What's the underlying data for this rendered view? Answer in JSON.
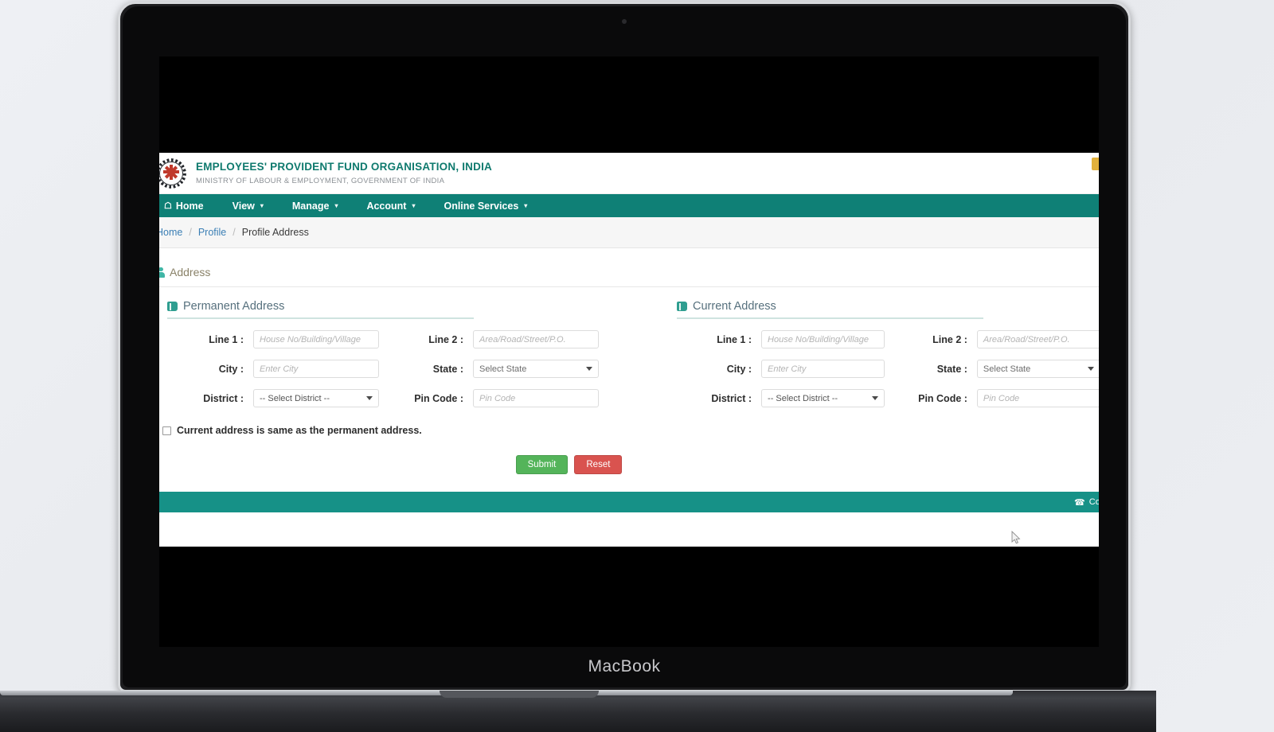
{
  "device": {
    "label": "MacBook"
  },
  "header": {
    "org_name": "EMPLOYEES' PROVIDENT FUND ORGANISATION, INDIA",
    "org_subtitle": "MINISTRY OF LABOUR & EMPLOYMENT, GOVERNMENT OF INDIA",
    "logo_icon": "epfo-emblem-icon"
  },
  "nav": {
    "items": [
      {
        "label": "Home",
        "icon": "home-icon",
        "caret": ""
      },
      {
        "label": "View",
        "icon": "",
        "caret": "▾"
      },
      {
        "label": "Manage",
        "icon": "",
        "caret": "▾"
      },
      {
        "label": "Account",
        "icon": "",
        "caret": "▾"
      },
      {
        "label": "Online Services",
        "icon": "",
        "caret": "▾"
      }
    ]
  },
  "breadcrumb": {
    "home": "Home",
    "sep1": "/",
    "profile": "Profile",
    "sep2": "/",
    "current": "Profile Address"
  },
  "panel": {
    "title": "Address",
    "icon": "user-icon"
  },
  "permanent": {
    "heading": "Permanent Address",
    "icon": "book-icon",
    "fields": {
      "line1_label": "Line 1 :",
      "line1_placeholder": "House No/Building/Village",
      "line2_label": "Line 2 :",
      "line2_placeholder": "Area/Road/Street/P.O.",
      "city_label": "City :",
      "city_placeholder": "Enter City",
      "state_label": "State :",
      "state_value": "Select State",
      "district_label": "District :",
      "district_value": "-- Select District --",
      "pin_label": "Pin Code :",
      "pin_placeholder": "Pin Code"
    }
  },
  "current": {
    "heading": "Current Address",
    "icon": "book-icon",
    "fields": {
      "line1_label": "Line 1 :",
      "line1_placeholder": "House No/Building/Village",
      "line2_label": "Line 2 :",
      "line2_placeholder": "Area/Road/Street/P.O.",
      "city_label": "City :",
      "city_placeholder": "Enter City",
      "state_label": "State :",
      "state_value": "Select State",
      "district_label": "District :",
      "district_value": "-- Select District --",
      "pin_label": "Pin Code :",
      "pin_placeholder": "Pin Code"
    }
  },
  "same_address": {
    "label": "Current address is same as the permanent address.",
    "checked": false
  },
  "actions": {
    "submit_label": "Submit",
    "reset_label": "Reset"
  },
  "footer": {
    "contact_label": "Cont",
    "phone_icon": "phone-icon"
  },
  "colors": {
    "teal": "#0f8076",
    "footer_teal": "#169187",
    "org_green": "#0f7a6e",
    "submit_green": "#54b45a",
    "reset_red": "#d9534f",
    "link_blue": "#3b7fb5"
  }
}
